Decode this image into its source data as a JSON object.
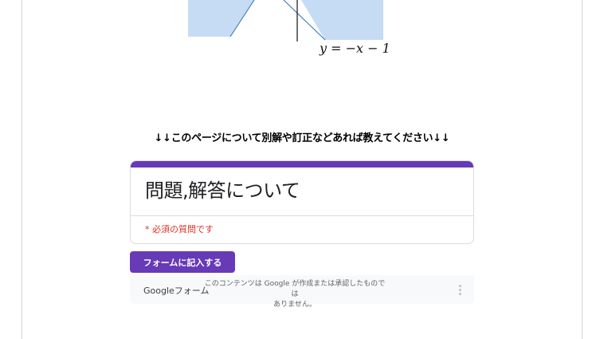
{
  "graph": {
    "formula": "y = −x − 1"
  },
  "notice": {
    "text": "↓↓このページについて別解や訂正などあれば教えてください↓↓"
  },
  "form": {
    "title": "問題,解答について",
    "required_note": "* 必須の質問です",
    "accent_color": "#673ab7",
    "fill_button_label": "フォームに記入する",
    "brand": "Googleフォーム",
    "disclaimer_line1": "このコンテンツは Google が作成または承認したものでは",
    "disclaimer_line2": "ありません。",
    "more_icon": "more-vert-icon"
  }
}
